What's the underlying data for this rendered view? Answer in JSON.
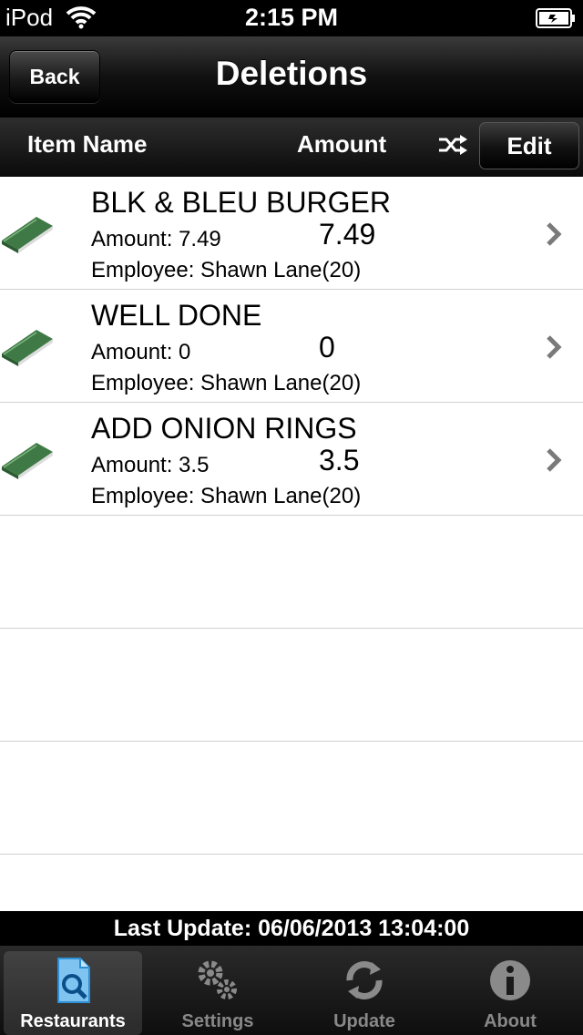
{
  "status_bar": {
    "carrier": "iPod",
    "time": "2:15 PM"
  },
  "nav": {
    "back_label": "Back",
    "title": "Deletions"
  },
  "header": {
    "item_name": "Item Name",
    "amount": "Amount",
    "edit_label": "Edit"
  },
  "rows": [
    {
      "name": "BLK & BLEU BURGER",
      "amount_label": "Amount: 7.49",
      "amount": "7.49",
      "employee": "Employee: Shawn Lane(20)"
    },
    {
      "name": "WELL DONE",
      "amount_label": "Amount: 0",
      "amount": "0",
      "employee": "Employee: Shawn Lane(20)"
    },
    {
      "name": "ADD ONION RINGS",
      "amount_label": "Amount: 3.5",
      "amount": "3.5",
      "employee": "Employee: Shawn Lane(20)"
    }
  ],
  "last_update": "Last Update: 06/06/2013 13:04:00",
  "tabs": [
    {
      "label": "Restaurants",
      "icon": "document-search-icon",
      "selected": true
    },
    {
      "label": "Settings",
      "icon": "gears-icon",
      "selected": false
    },
    {
      "label": "Update",
      "icon": "refresh-icon",
      "selected": false
    },
    {
      "label": "About",
      "icon": "info-icon",
      "selected": false
    }
  ],
  "colors": {
    "book_green": "#3f7a46",
    "chevron": "#7a7a7a",
    "tab_selected_blue": "#2d8fd6"
  }
}
